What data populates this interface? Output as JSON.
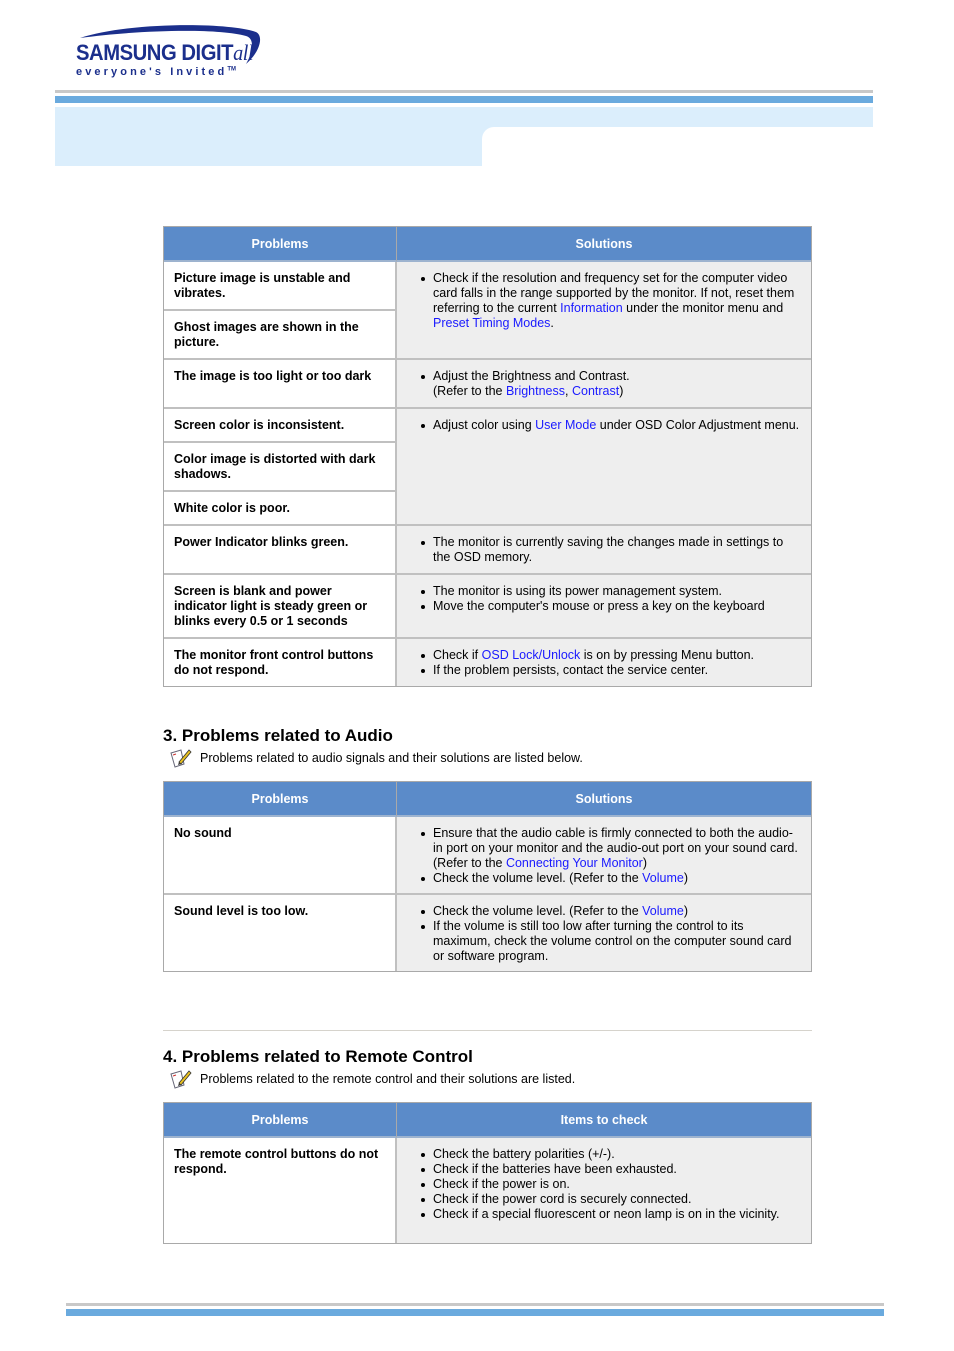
{
  "header": {
    "logo_brand": "SAMSUNG DIGIT",
    "logo_brand_suffix": "all",
    "logo_tagline": "everyone's Invited",
    "logo_tm": "TM"
  },
  "table1": {
    "headers": [
      "Problems",
      "Solutions"
    ],
    "rows": [
      {
        "problems": [
          "Picture image is unstable and vibrates.",
          "Ghost images are shown in the picture."
        ],
        "solution": [
          {
            "parts": [
              {
                "t": "Check if the resolution and frequency set for the computer video card falls in the range supported by the monitor. If not, reset them referring to the current "
              },
              {
                "link": "Information"
              },
              {
                "t": " under the monitor menu and "
              },
              {
                "link": "Preset Timing Modes"
              },
              {
                "t": "."
              }
            ]
          }
        ]
      },
      {
        "problems": [
          "The image is too light or too dark"
        ],
        "solution": [
          {
            "parts": [
              {
                "t": "Adjust the Brightness and Contrast."
              },
              {
                "br": true
              },
              {
                "t": "(Refer to the "
              },
              {
                "link": "Brightness"
              },
              {
                "t": ", "
              },
              {
                "link": "Contrast"
              },
              {
                "t": ")"
              }
            ]
          }
        ]
      },
      {
        "problems": [
          "Screen color is inconsistent.",
          "Color image is distorted with dark shadows.",
          "White color is poor."
        ],
        "solution": [
          {
            "parts": [
              {
                "t": "Adjust color using "
              },
              {
                "link": "User Mode"
              },
              {
                "t": " under OSD Color Adjustment menu."
              }
            ]
          }
        ]
      },
      {
        "problems": [
          "Power Indicator blinks green."
        ],
        "solution": [
          {
            "parts": [
              {
                "t": "The monitor is currently saving the changes made in settings to the OSD memory."
              }
            ]
          }
        ]
      },
      {
        "problems": [
          "Screen is blank and power indicator light is steady green or blinks every 0.5 or 1 seconds"
        ],
        "solution": [
          {
            "parts": [
              {
                "t": "The monitor is using its power management system."
              }
            ]
          },
          {
            "parts": [
              {
                "t": "Move the computer's mouse or press a key on the keyboard"
              }
            ]
          }
        ]
      },
      {
        "problems": [
          "The monitor front control buttons do not respond."
        ],
        "solution": [
          {
            "parts": [
              {
                "t": "Check if "
              },
              {
                "link": "OSD Lock/Unlock"
              },
              {
                "t": " is on by pressing Menu button."
              }
            ]
          },
          {
            "parts": [
              {
                "t": "If the problem persists, contact the service center."
              }
            ]
          }
        ]
      }
    ]
  },
  "section3": {
    "title": "3. Problems related to Audio",
    "note": "Problems related to audio signals and their solutions are listed below.",
    "headers": [
      "Problems",
      "Solutions"
    ],
    "rows": [
      {
        "problems": [
          "No sound"
        ],
        "solution": [
          {
            "parts": [
              {
                "t": "Ensure that the audio cable is firmly connected to both the audio-in port on your monitor and the audio-out port on your sound card. (Refer to the "
              },
              {
                "link": "Connecting Your Monitor"
              },
              {
                "t": ")"
              }
            ]
          },
          {
            "parts": [
              {
                "t": "Check the volume level. (Refer to the "
              },
              {
                "link": "Volume"
              },
              {
                "t": ")"
              }
            ]
          }
        ]
      },
      {
        "problems": [
          "Sound level is too low."
        ],
        "solution": [
          {
            "parts": [
              {
                "t": "Check the volume level. (Refer to the "
              },
              {
                "link": "Volume"
              },
              {
                "t": ")"
              }
            ]
          },
          {
            "parts": [
              {
                "t": "If the volume is still too low after turning the control to its maximum, check the volume control on the computer sound card or software program."
              }
            ]
          }
        ]
      }
    ]
  },
  "section4": {
    "title": "4. Problems related to Remote Control",
    "note": "Problems related to the remote control and their solutions are listed.",
    "headers": [
      "Problems",
      "Items to check"
    ],
    "rows": [
      {
        "problems": [
          "The remote control buttons do not respond."
        ],
        "solution": [
          {
            "parts": [
              {
                "t": "Check the battery polarities (+/-)."
              }
            ]
          },
          {
            "parts": [
              {
                "t": "Check if the batteries have been exhausted."
              }
            ]
          },
          {
            "parts": [
              {
                "t": "Check if the power is on."
              }
            ]
          },
          {
            "parts": [
              {
                "t": "Check if the power cord is securely connected."
              }
            ]
          },
          {
            "parts": [
              {
                "t": "Check if a special fluorescent or neon lamp is on in the vicinity."
              }
            ]
          }
        ]
      }
    ]
  },
  "colors": {
    "header_blue": "#5b8bc9",
    "link_blue": "#1a1aff",
    "band_light": "#dbeefc",
    "bar_blue": "#6aaade",
    "solution_bg": "#eeeeee"
  }
}
